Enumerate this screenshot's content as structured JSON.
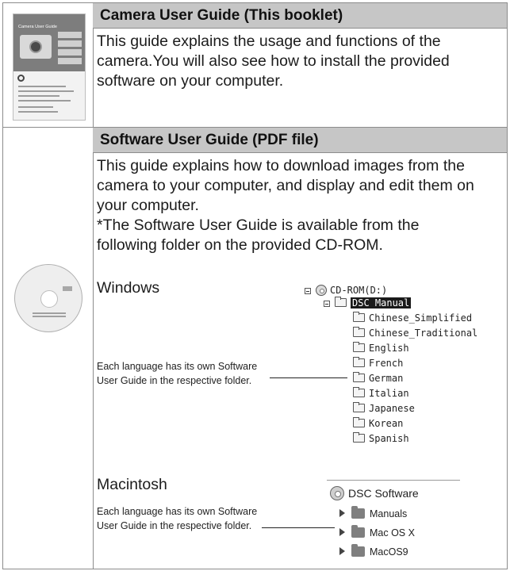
{
  "section1": {
    "title": "Camera User Guide (This booklet)",
    "lines": [
      "This guide explains the usage and functions of the",
      "camera.You will also see how to install the provided",
      "software on your computer."
    ],
    "booklet_title": "Camera User Guide"
  },
  "section2": {
    "title": "Software User Guide (PDF file)",
    "lines": [
      "This guide explains how to download images from the",
      "camera to your computer, and display and edit them on",
      "your computer.",
      "*The Software User Guide is available from the",
      "following folder on the provided CD-ROM."
    ],
    "windows": {
      "heading": "Windows",
      "note_lines": [
        "Each language has its own Software",
        "User Guide in the respective folder."
      ],
      "root": "CD-ROM(D:)",
      "manual_folder": "DSC Manual",
      "languages": [
        "Chinese_Simplified",
        "Chinese_Traditional",
        "English",
        "French",
        "German",
        "Italian",
        "Japanese",
        "Korean",
        "Spanish"
      ]
    },
    "macintosh": {
      "heading": "Macintosh",
      "note_lines": [
        "Each language has its own Software",
        "User Guide in the respective folder."
      ],
      "root": "DSC Software",
      "folders": [
        "Manuals",
        "Mac OS X",
        "MacOS9"
      ]
    }
  }
}
